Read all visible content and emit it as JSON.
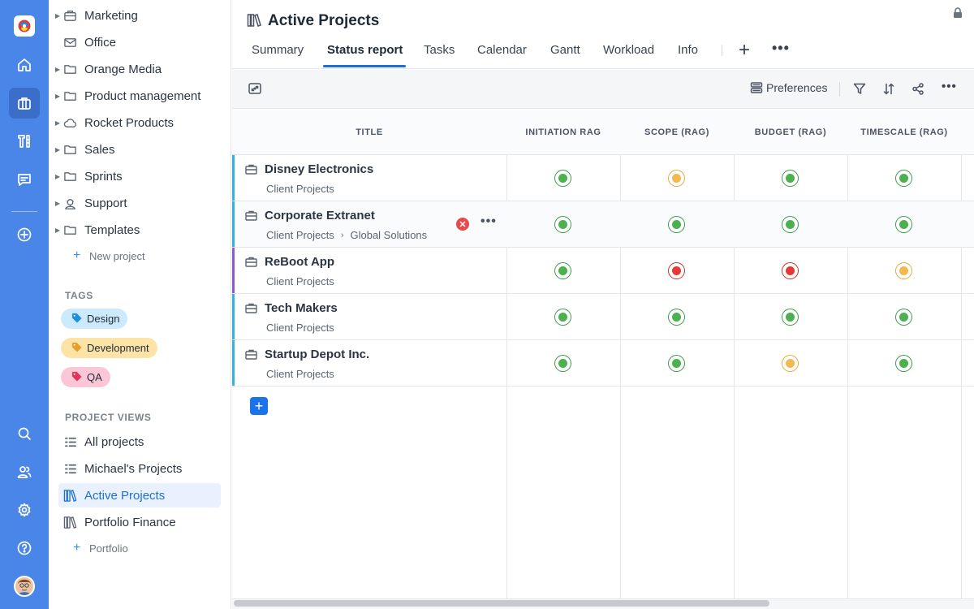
{
  "rail": {
    "icons": [
      "home-icon",
      "briefcase-icon",
      "tools-icon",
      "chat-icon",
      "add-circle-icon",
      "search-icon",
      "people-icon",
      "settings-icon",
      "help-icon"
    ]
  },
  "sidebar": {
    "folders": [
      {
        "label": "Marketing",
        "icon": "briefcase-icon",
        "caret": true
      },
      {
        "label": "Office",
        "icon": "mail-icon",
        "caret": false
      },
      {
        "label": "Orange Media",
        "icon": "folder-icon",
        "caret": true
      },
      {
        "label": "Product management",
        "icon": "folder-icon",
        "caret": true
      },
      {
        "label": "Rocket Products",
        "icon": "cloud-icon",
        "caret": true
      },
      {
        "label": "Sales",
        "icon": "folder-icon",
        "caret": true
      },
      {
        "label": "Sprints",
        "icon": "folder-icon",
        "caret": true
      },
      {
        "label": "Support",
        "icon": "support-icon",
        "caret": true
      },
      {
        "label": "Templates",
        "icon": "folder-icon",
        "caret": true
      }
    ],
    "new_project": "New project",
    "tags_label": "TAGS",
    "tags": [
      {
        "label": "Design",
        "color": "#cdeafd",
        "icon_color": "#1e90e0"
      },
      {
        "label": "Development",
        "color": "#fde4a6",
        "icon_color": "#e4a02a"
      },
      {
        "label": "QA",
        "color": "#fbc6d6",
        "icon_color": "#e0345c"
      }
    ],
    "views_label": "PROJECT VIEWS",
    "views": [
      {
        "label": "All projects",
        "icon": "list-icon"
      },
      {
        "label": "Michael's Projects",
        "icon": "list-icon"
      },
      {
        "label": "Active Projects",
        "icon": "books-icon",
        "selected": true
      },
      {
        "label": "Portfolio Finance",
        "icon": "books-icon"
      }
    ],
    "add_portfolio": "Portfolio"
  },
  "header": {
    "title": "Active Projects",
    "tabs": [
      "Summary",
      "Status report",
      "Tasks",
      "Calendar",
      "Gantt",
      "Workload",
      "Info"
    ],
    "active_tab": "Status report"
  },
  "toolbar": {
    "preferences": "Preferences"
  },
  "table": {
    "columns": [
      "TITLE",
      "INITIATION RAG",
      "SCOPE (RAG)",
      "BUDGET (RAG)",
      "TIMESCALE (RAG)"
    ],
    "rows": [
      {
        "name": "Disney Electronics",
        "path": [
          "Client Projects"
        ],
        "accent": "#3ab0e0",
        "rags": [
          "green",
          "amber",
          "green",
          "green"
        ]
      },
      {
        "name": "Corporate Extranet",
        "path": [
          "Client Projects",
          "Global Solutions"
        ],
        "accent": "#3ab0e0",
        "rags": [
          "green",
          "green",
          "green",
          "green"
        ]
      },
      {
        "name": "ReBoot App",
        "path": [
          "Client Projects"
        ],
        "accent": "#8a5cd0",
        "rags": [
          "green",
          "red",
          "red",
          "amber"
        ]
      },
      {
        "name": "Tech Makers",
        "path": [
          "Client Projects"
        ],
        "accent": "#3ab0e0",
        "rags": [
          "green",
          "green",
          "green",
          "green"
        ]
      },
      {
        "name": "Startup Depot Inc.",
        "path": [
          "Client Projects"
        ],
        "accent": "#3ab0e0",
        "rags": [
          "green",
          "green",
          "amber",
          "green"
        ]
      }
    ]
  }
}
